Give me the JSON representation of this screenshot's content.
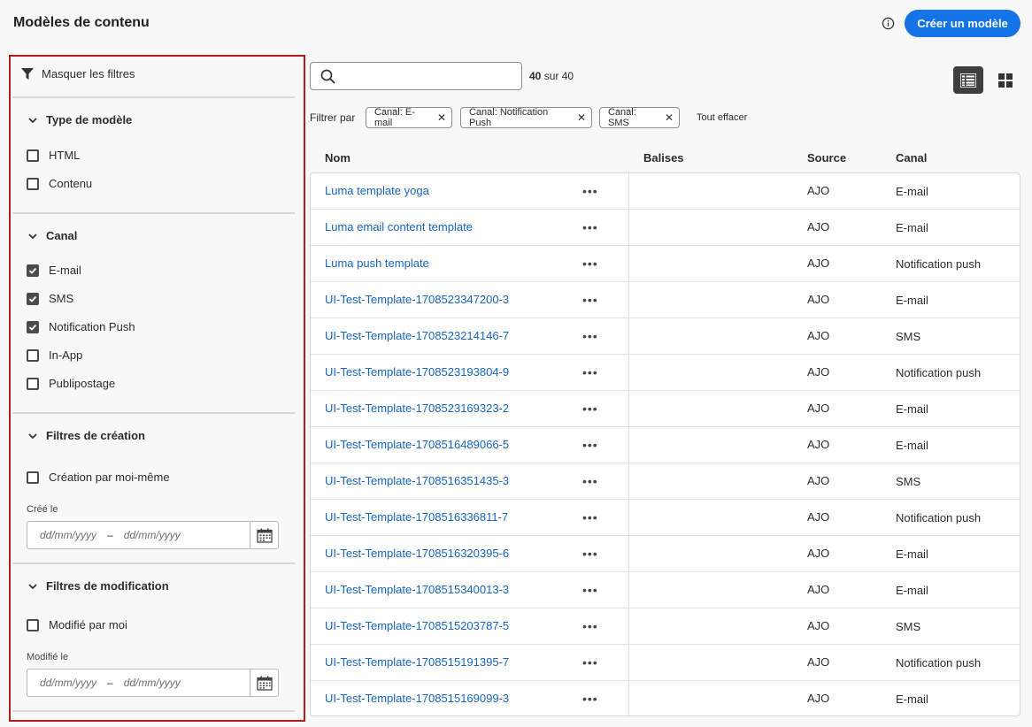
{
  "header": {
    "title": "Modèles de contenu",
    "create_button": "Créer un modèle"
  },
  "filters_panel": {
    "hide_filters": "Masquer les filtres",
    "sections": {
      "template_type": {
        "title": "Type de modèle",
        "options": [
          {
            "label": "HTML",
            "checked": false
          },
          {
            "label": "Contenu",
            "checked": false
          }
        ]
      },
      "channel": {
        "title": "Canal",
        "options": [
          {
            "label": "E-mail",
            "checked": true
          },
          {
            "label": "SMS",
            "checked": true
          },
          {
            "label": "Notification Push",
            "checked": true
          },
          {
            "label": "In-App",
            "checked": false
          },
          {
            "label": "Publipostage",
            "checked": false
          }
        ]
      },
      "creation": {
        "title": "Filtres de création",
        "checkbox": "Création par moi-même",
        "date_label": "Créé le",
        "date_from_placeholder": "dd/mm/yyyy",
        "date_to_placeholder": "dd/mm/yyyy",
        "date_separator": "–"
      },
      "modification": {
        "title": "Filtres de modification",
        "checkbox": "Modifié par moi",
        "date_label": "Modifié le",
        "date_from_placeholder": "dd/mm/yyyy",
        "date_to_placeholder": "dd/mm/yyyy",
        "date_separator": "–"
      }
    }
  },
  "toolbar": {
    "search_value": "",
    "count_current": "40",
    "count_suffix": "sur 40",
    "filter_by": "Filtrer par",
    "tags": [
      "Canal: E-mail",
      "Canal: Notification Push",
      "Canal: SMS"
    ],
    "clear_all": "Tout effacer"
  },
  "table": {
    "columns": [
      "Nom",
      "Balises",
      "Source",
      "Canal"
    ],
    "rows": [
      {
        "name": "Luma template yoga",
        "source": "AJO",
        "channel": "E-mail"
      },
      {
        "name": "Luma email content template",
        "source": "AJO",
        "channel": "E-mail"
      },
      {
        "name": "Luma push template",
        "source": "AJO",
        "channel": "Notification push"
      },
      {
        "name": "UI-Test-Template-1708523347200-3",
        "source": "AJO",
        "channel": "E-mail"
      },
      {
        "name": "UI-Test-Template-1708523214146-7",
        "source": "AJO",
        "channel": "SMS"
      },
      {
        "name": "UI-Test-Template-1708523193804-9",
        "source": "AJO",
        "channel": "Notification push"
      },
      {
        "name": "UI-Test-Template-1708523169323-2",
        "source": "AJO",
        "channel": "E-mail"
      },
      {
        "name": "UI-Test-Template-1708516489066-5",
        "source": "AJO",
        "channel": "E-mail"
      },
      {
        "name": "UI-Test-Template-1708516351435-3",
        "source": "AJO",
        "channel": "SMS"
      },
      {
        "name": "UI-Test-Template-1708516336811-7",
        "source": "AJO",
        "channel": "Notification push"
      },
      {
        "name": "UI-Test-Template-1708516320395-6",
        "source": "AJO",
        "channel": "E-mail"
      },
      {
        "name": "UI-Test-Template-1708515340013-3",
        "source": "AJO",
        "channel": "E-mail"
      },
      {
        "name": "UI-Test-Template-1708515203787-5",
        "source": "AJO",
        "channel": "SMS"
      },
      {
        "name": "UI-Test-Template-1708515191395-7",
        "source": "AJO",
        "channel": "Notification push"
      },
      {
        "name": "UI-Test-Template-1708515169099-3",
        "source": "AJO",
        "channel": "E-mail"
      }
    ],
    "more_label": "•••"
  },
  "colors": {
    "accent": "#1473e6",
    "link": "#1665c0",
    "highlight_border": "#b21e1e"
  }
}
